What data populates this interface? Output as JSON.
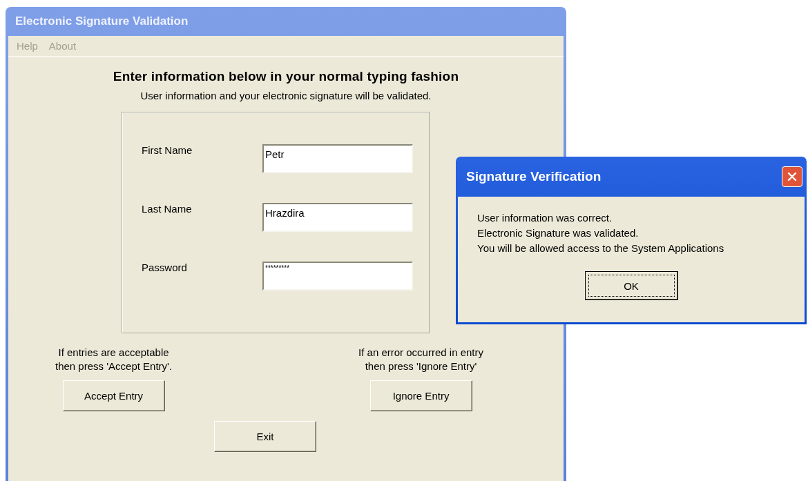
{
  "window": {
    "title": "Electronic Signature Validation"
  },
  "menu": [
    {
      "label": "Help",
      "disabled": true
    },
    {
      "label": "About",
      "disabled": true
    }
  ],
  "heading": "Enter information below in your normal typing fashion",
  "subheading": "User information and your electronic signature will be validated.",
  "fields": [
    {
      "label": "First Name",
      "value": "Petr",
      "kind": "text"
    },
    {
      "label": "Last Name",
      "value": "Hrazdira",
      "kind": "text"
    },
    {
      "label": "Password",
      "value": "*********",
      "kind": "password"
    }
  ],
  "accept": {
    "hint": [
      "If entries are acceptable",
      "then press 'Accept Entry'."
    ],
    "button": "Accept Entry"
  },
  "ignore": {
    "hint": [
      "If an error occurred in entry",
      "then press 'Ignore Entry'"
    ],
    "button": "Ignore Entry"
  },
  "exit_button": "Exit",
  "dialog": {
    "title": "Signature Verification",
    "lines": [
      "User information was correct.",
      "Electronic Signature was validated.",
      "You will be allowed access to the System Applications"
    ],
    "button": "OK",
    "button_focused": true
  }
}
